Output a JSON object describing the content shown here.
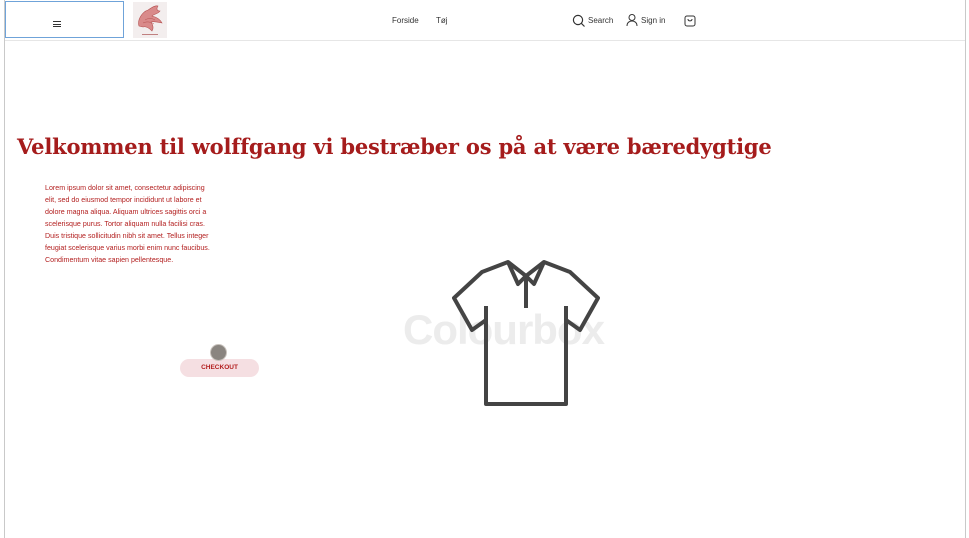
{
  "header": {
    "nav": {
      "home": "Forside",
      "clothes": "Tøj"
    },
    "search_label": "Search",
    "signin_label": "Sign in"
  },
  "main": {
    "title": "Velkommen til wolffgang vi bestræber os på at være bæredygtige",
    "paragraph": "Lorem ipsum dolor sit amet, consectetur adipiscing elit, sed do eiusmod tempor incididunt ut labore et dolore magna aliqua. Aliquam ultrices sagittis orci a scelerisque purus. Tortor aliquam nulla facilisi cras. Duis tristique sollicitudin nibh sit amet. Tellus integer feugiat scelerisque varius morbi enim nunc faucibus. Condimentum vitae sapien pellentesque.",
    "checkout_label": "CHECKOUT",
    "watermark": "Colourbox"
  },
  "icons": {
    "menu": "hamburger-icon",
    "search": "search-icon",
    "user": "user-icon",
    "bag": "shopping-bag-icon",
    "product": "polo-shirt-icon"
  },
  "colors": {
    "accent": "#a51c1c",
    "checkout_bg": "#f5dfe2",
    "menu_border": "#6fa3d9"
  }
}
